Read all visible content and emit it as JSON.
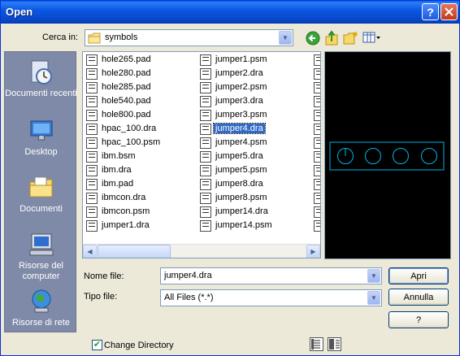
{
  "window": {
    "title": "Open",
    "help_label": "?",
    "close_label": "✕"
  },
  "lookin": {
    "label": "Cerca in:",
    "value": "symbols"
  },
  "toolbar": {
    "icons": [
      "back-icon",
      "up-folder-icon",
      "new-folder-icon",
      "view-menu-icon"
    ]
  },
  "places": [
    {
      "label": "Documenti recenti",
      "icon": "recent-documents-icon"
    },
    {
      "label": "Desktop",
      "icon": "desktop-icon"
    },
    {
      "label": "Documenti",
      "icon": "documents-folder-icon"
    },
    {
      "label": "Risorse del computer",
      "icon": "my-computer-icon"
    },
    {
      "label": "Risorse di rete",
      "icon": "network-icon"
    }
  ],
  "files": {
    "column1": [
      "hole265.pad",
      "hole280.pad",
      "hole285.pad",
      "hole540.pad",
      "hole800.pad",
      "hpac_100.dra",
      "hpac_100.psm",
      "ibm.bsm",
      "ibm.dra",
      "ibm.pad",
      "ibmcon.dra",
      "ibmcon.psm",
      "jumper1.dra"
    ],
    "column2": [
      "jumper1.psm",
      "jumper2.dra",
      "jumper2.psm",
      "jumper3.dra",
      "jumper3.psm",
      "jumper4.dra",
      "jumper4.psm",
      "jumper5.dra",
      "jumper5.psm",
      "jumper8.dra",
      "jumper8.psm",
      "jumper14.dra",
      "jumper14.psm"
    ],
    "selected": "jumper4.dra"
  },
  "filename": {
    "label": "Nome file:",
    "value": "jumper4.dra"
  },
  "filetype": {
    "label": "Tipo file:",
    "value": "All Files (*.*)"
  },
  "buttons": {
    "open": "Apri",
    "cancel": "Annulla",
    "help": "?"
  },
  "change_directory": {
    "label": "Change Directory",
    "checked": true
  },
  "colors": {
    "preview_background": "#000000",
    "preview_stroke": "#00b4e6",
    "selection": "#316ac5",
    "titlebar": "#0b58e2"
  }
}
